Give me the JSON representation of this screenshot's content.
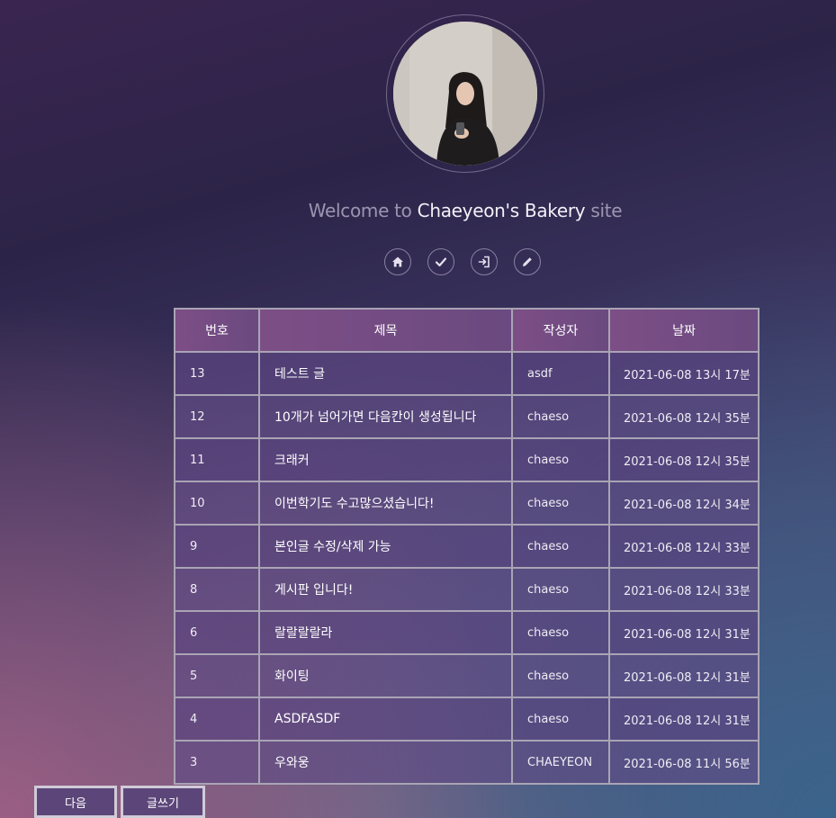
{
  "profile": {
    "avatar_alt": "profile photo"
  },
  "welcome": {
    "prefix": "Welcome to ",
    "name": "Chaeyeon's Bakery",
    "suffix": " site"
  },
  "icons": [
    {
      "name": "home-icon"
    },
    {
      "name": "check-icon"
    },
    {
      "name": "sign-in-icon"
    },
    {
      "name": "pencil-icon"
    }
  ],
  "board": {
    "headers": [
      "번호",
      "제목",
      "작성자",
      "날짜"
    ],
    "rows": [
      {
        "no": "13",
        "title": "테스트 글",
        "author": "asdf",
        "date": "2021-06-08 13시 17분"
      },
      {
        "no": "12",
        "title": "10개가 넘어가면 다음칸이 생성됩니다",
        "author": "chaeso",
        "date": "2021-06-08 12시 35분"
      },
      {
        "no": "11",
        "title": "크래커",
        "author": "chaeso",
        "date": "2021-06-08 12시 35분"
      },
      {
        "no": "10",
        "title": "이번학기도 수고많으셨습니다!",
        "author": "chaeso",
        "date": "2021-06-08 12시 34분"
      },
      {
        "no": "9",
        "title": "본인글 수정/삭제 가능",
        "author": "chaeso",
        "date": "2021-06-08 12시 33분"
      },
      {
        "no": "8",
        "title": "게시판 입니다!",
        "author": "chaeso",
        "date": "2021-06-08 12시 33분"
      },
      {
        "no": "6",
        "title": "랄랄랄랄라",
        "author": "chaeso",
        "date": "2021-06-08 12시 31분"
      },
      {
        "no": "5",
        "title": "화이팅",
        "author": "chaeso",
        "date": "2021-06-08 12시 31분"
      },
      {
        "no": "4",
        "title": "ASDFASDF",
        "author": "chaeso",
        "date": "2021-06-08 12시 31분"
      },
      {
        "no": "3",
        "title": "우와웅",
        "author": "CHAEYEON",
        "date": "2021-06-08 11시 56분"
      }
    ]
  },
  "buttons": {
    "next": "다음",
    "write": "글쓰기"
  },
  "colors": {
    "header_bg": "#7d4e86",
    "row_bg": "#5a4480",
    "border": "#a9a4b4",
    "button_bg": "#5c4679"
  }
}
